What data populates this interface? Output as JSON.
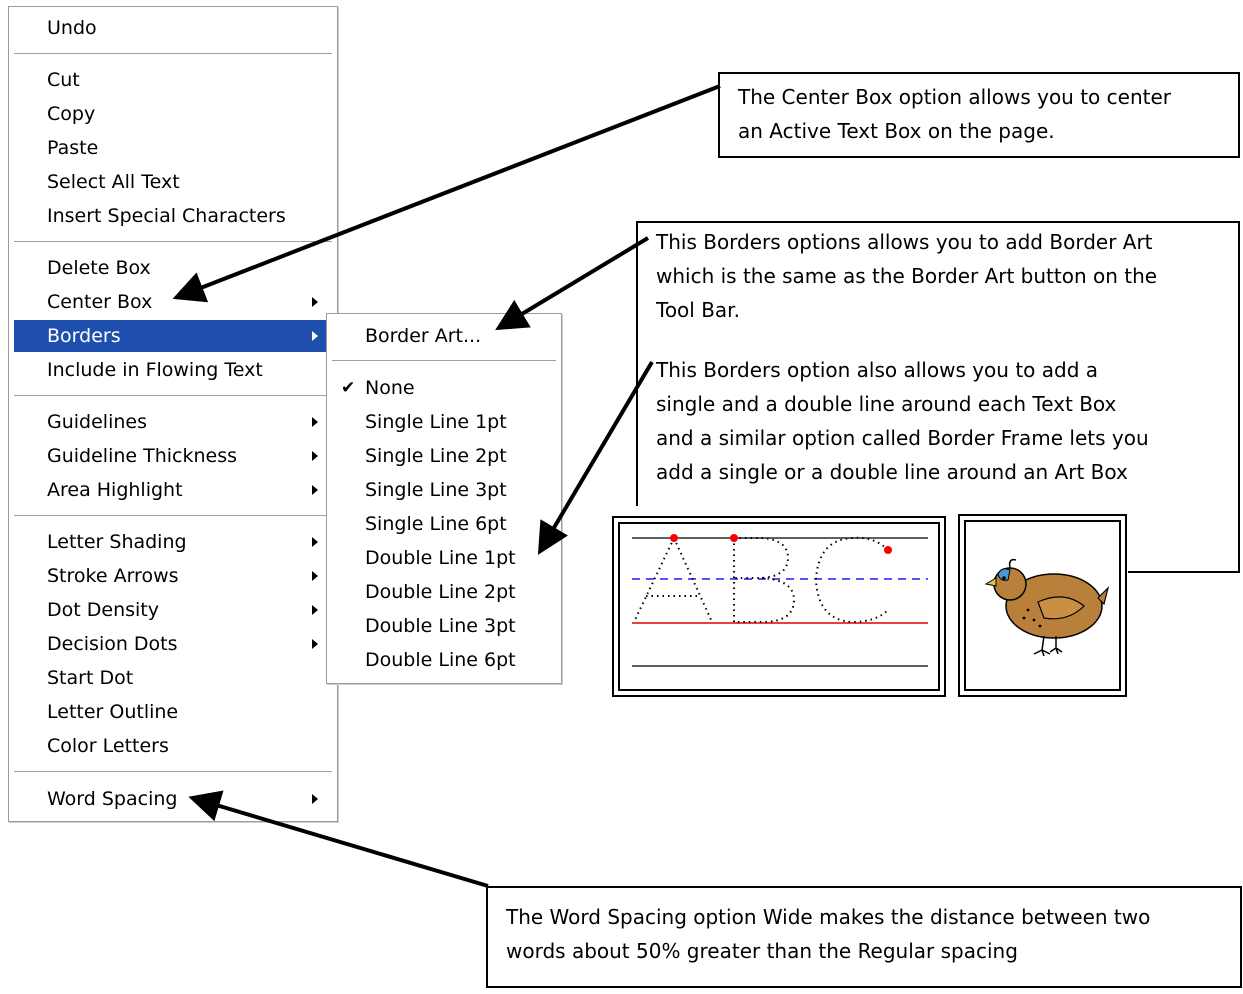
{
  "context_menu": {
    "items": [
      {
        "label": "Undo"
      },
      {
        "label": "Cut"
      },
      {
        "label": "Copy"
      },
      {
        "label": "Paste"
      },
      {
        "label": "Select All Text"
      },
      {
        "label": "Insert Special Characters"
      },
      {
        "label": "Delete Box"
      },
      {
        "label": "Center Box",
        "submenu": true
      },
      {
        "label": "Borders",
        "submenu": true,
        "selected": true
      },
      {
        "label": "Include in Flowing Text"
      },
      {
        "label": "Guidelines",
        "submenu": true
      },
      {
        "label": "Guideline Thickness",
        "submenu": true
      },
      {
        "label": "Area Highlight",
        "submenu": true
      },
      {
        "label": "Letter Shading",
        "submenu": true
      },
      {
        "label": "Stroke Arrows",
        "submenu": true
      },
      {
        "label": "Dot Density",
        "submenu": true
      },
      {
        "label": "Decision Dots",
        "submenu": true
      },
      {
        "label": "Start Dot"
      },
      {
        "label": "Letter Outline"
      },
      {
        "label": "Color Letters"
      },
      {
        "label": "Word Spacing",
        "submenu": true
      }
    ]
  },
  "borders_submenu": {
    "items": [
      {
        "label": "Border Art..."
      },
      {
        "label": "None",
        "checked": true
      },
      {
        "label": "Single Line 1pt"
      },
      {
        "label": "Single Line 2pt"
      },
      {
        "label": "Single Line 3pt"
      },
      {
        "label": "Single Line 6pt"
      },
      {
        "label": "Double Line 1pt"
      },
      {
        "label": "Double Line 2pt"
      },
      {
        "label": "Double Line 3pt"
      },
      {
        "label": "Double Line 6pt"
      }
    ]
  },
  "callouts": {
    "center_box": {
      "line1": "The Center Box option allows you to center",
      "line2": "an Active Text Box on the page."
    },
    "borders": {
      "p1_line1": "This Borders options allows you to add Border Art",
      "p1_line2": "which is the same as the Border Art button on the",
      "p1_line3": "Tool Bar.",
      "p2_line1": "This Borders option also allows you to add a",
      "p2_line2": "single and a double line around each Text Box",
      "p2_line3": "and a similar option called Border Frame lets you",
      "p2_line4": "add a single or a double line around an Art Box"
    },
    "word_spacing": {
      "line1": "The Word Spacing option Wide makes the distance between two",
      "line2": "words about 50% greater than the Regular spacing"
    }
  },
  "sample_text_box": {
    "letters": "ABC"
  },
  "colors": {
    "menu_highlight": "#1f4fae",
    "guideline_red": "#e00000",
    "guideline_blue": "#1a1aff",
    "start_dot": "#ff0000",
    "bird": "#b8803a"
  },
  "icons": {
    "check": "checkmark-icon",
    "submenu": "submenu-arrow-icon",
    "bird": "quail-clipart"
  }
}
